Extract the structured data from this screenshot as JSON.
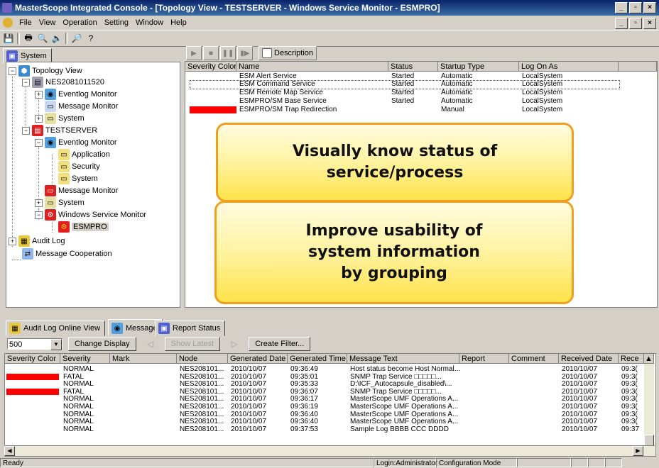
{
  "window": {
    "title": "MasterScope Integrated Console - [Topology View - TESTSERVER - Windows Service Monitor - ESMPRO]"
  },
  "menu": [
    "File",
    "View",
    "Operation",
    "Setting",
    "Window",
    "Help"
  ],
  "left_tab": "System",
  "tree": [
    {
      "label": "Topology View"
    },
    {
      "label": "NES2081011520"
    },
    {
      "label": "Eventlog Monitor"
    },
    {
      "label": "Message Monitor"
    },
    {
      "label": "System"
    },
    {
      "label": "TESTSERVER"
    },
    {
      "label": "Eventlog Monitor"
    },
    {
      "label": "Application"
    },
    {
      "label": "Security"
    },
    {
      "label": "System"
    },
    {
      "label": "Message Monitor"
    },
    {
      "label": "System"
    },
    {
      "label": "Windows Service Monitor"
    },
    {
      "label": "ESMPRO"
    },
    {
      "label": "Audit Log"
    },
    {
      "label": "Message Cooperation"
    }
  ],
  "description_button": "Description",
  "services": {
    "columns": [
      "Severity Color",
      "Name",
      "Status",
      "Startup Type",
      "Log On As"
    ],
    "rows": [
      {
        "name": "ESM Alert Service",
        "status": "Started",
        "startup": "Automatic",
        "logon": "LocalSystem",
        "color": ""
      },
      {
        "name": "ESM Command Service",
        "status": "Started",
        "startup": "Automatic",
        "logon": "LocalSystem",
        "color": ""
      },
      {
        "name": "ESM Remote Map Service",
        "status": "Started",
        "startup": "Automatic",
        "logon": "LocalSystem",
        "color": ""
      },
      {
        "name": "ESMPRO/SM Base Service",
        "status": "Started",
        "startup": "Automatic",
        "logon": "LocalSystem",
        "color": ""
      },
      {
        "name": "ESMPRO/SM Trap Redirection",
        "status": "",
        "startup": "Manual",
        "logon": "LocalSystem",
        "color": "#ff0000"
      }
    ]
  },
  "callouts": {
    "one": "Visually know status of\nservice/process",
    "two": "Improve usability of\nsystem information\nby grouping"
  },
  "bottom_tabs": [
    "Audit Log Online View",
    "Message",
    "Report Status"
  ],
  "bottom_toolbar": {
    "count": "500",
    "change_display": "Change Display",
    "show_latest": "Show Latest",
    "create_filter": "Create Filter..."
  },
  "messages": {
    "columns": [
      "Severity Color",
      "Severity",
      "Mark",
      "Node",
      "Generated Date",
      "Generated Time",
      "Message Text",
      "Report",
      "Comment",
      "Received Date",
      "Rece"
    ],
    "rows": [
      {
        "color": "",
        "severity": "NORMAL",
        "node": "NES208101...",
        "gdate": "2010/10/07",
        "gtime": "09:36:49",
        "text": "Host status become Host Normal...",
        "rdate": "2010/10/07",
        "rtime": "09:3("
      },
      {
        "color": "#ff0000",
        "severity": "FATAL",
        "node": "NES208101...",
        "gdate": "2010/10/07",
        "gtime": "09:35:01",
        "text": "SNMP Trap Service □□□□□...",
        "rdate": "2010/10/07",
        "rtime": "09:3("
      },
      {
        "color": "",
        "severity": "NORMAL",
        "node": "NES208101...",
        "gdate": "2010/10/07",
        "gtime": "09:35:33",
        "text": "D:\\ICF_Autocapsule_disabled\\...",
        "rdate": "2010/10/07",
        "rtime": "09:3("
      },
      {
        "color": "#ff0000",
        "severity": "FATAL",
        "node": "NES208101...",
        "gdate": "2010/10/07",
        "gtime": "09:36:07",
        "text": "SNMP Trap Service □□□□□...",
        "rdate": "2010/10/07",
        "rtime": "09:3("
      },
      {
        "color": "",
        "severity": "NORMAL",
        "node": "NES208101...",
        "gdate": "2010/10/07",
        "gtime": "09:36:17",
        "text": "MasterScope UMF Operations A...",
        "rdate": "2010/10/07",
        "rtime": "09:3("
      },
      {
        "color": "",
        "severity": "NORMAL",
        "node": "NES208101...",
        "gdate": "2010/10/07",
        "gtime": "09:36:19",
        "text": "MasterScope UMF Operations A...",
        "rdate": "2010/10/07",
        "rtime": "09:3("
      },
      {
        "color": "",
        "severity": "NORMAL",
        "node": "NES208101...",
        "gdate": "2010/10/07",
        "gtime": "09:36:40",
        "text": "MasterScope UMF Operations A...",
        "rdate": "2010/10/07",
        "rtime": "09:3("
      },
      {
        "color": "",
        "severity": "NORMAL",
        "node": "NES208101...",
        "gdate": "2010/10/07",
        "gtime": "09:36:40",
        "text": "MasterScope UMF Operations A...",
        "rdate": "2010/10/07",
        "rtime": "09:3("
      },
      {
        "color": "",
        "severity": "NORMAL",
        "node": "NES208101...",
        "gdate": "2010/10/07",
        "gtime": "09:37:53",
        "text": "Sample Log BBBB CCC DDDD",
        "rdate": "2010/10/07",
        "rtime": "09:37"
      }
    ]
  },
  "status": {
    "left": "Ready",
    "login": "Login:Administrator",
    "mode": "Configuration Mode"
  }
}
